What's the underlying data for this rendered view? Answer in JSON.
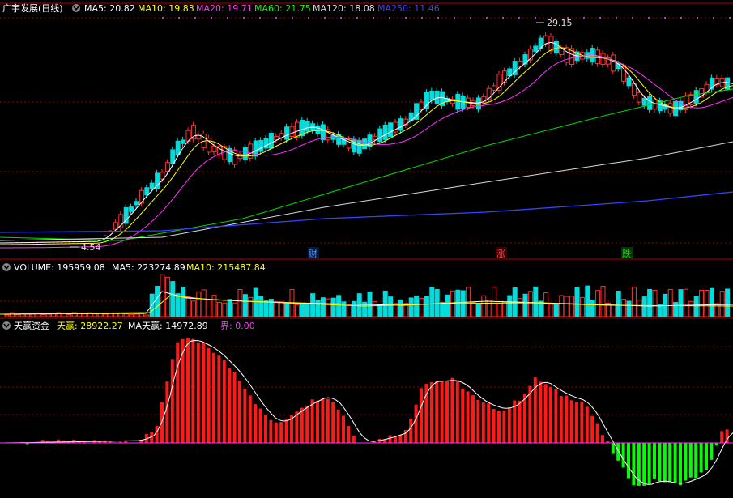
{
  "price_panel": {
    "title": "广宇发展(日线)",
    "indicators": [
      {
        "label": "MA5: 20.82",
        "color": "#ffffff"
      },
      {
        "label": "MA10: 19.83",
        "color": "#ffff00"
      },
      {
        "label": "MA20: 19.71",
        "color": "#ff33ff"
      },
      {
        "label": "MA60: 21.75",
        "color": "#00ff00"
      },
      {
        "label": "MA120: 18.08",
        "color": "#dddddd"
      },
      {
        "label": "MA250: 11.46",
        "color": "#3344ff"
      }
    ],
    "high_label": "29.15",
    "low_label": "4.54",
    "markers": [
      {
        "label": "财",
        "color": "#4a8cff"
      },
      {
        "label": "涨",
        "color": "#ff4040"
      },
      {
        "label": "跌",
        "color": "#00e000"
      }
    ]
  },
  "volume_panel": {
    "title": "VOLUME: 195959.08",
    "indicators": [
      {
        "label": "MA5: 223274.89",
        "color": "#ffffff"
      },
      {
        "label": "MA10: 215487.84",
        "color": "#ffff00"
      }
    ]
  },
  "fund_panel": {
    "title": "天赢资金",
    "indicators": [
      {
        "label": "天赢: 28922.27",
        "color": "#ffff00"
      },
      {
        "label": "MA天赢: 14972.89",
        "color": "#ffffff"
      },
      {
        "label": "界: 0.00",
        "color": "#ff33ff"
      }
    ]
  },
  "colors": {
    "up": "#ff3333",
    "down": "#00dddd",
    "fund_pos": "#ff1a1a",
    "fund_neg": "#00ff00",
    "grid": "#8b0000"
  }
}
